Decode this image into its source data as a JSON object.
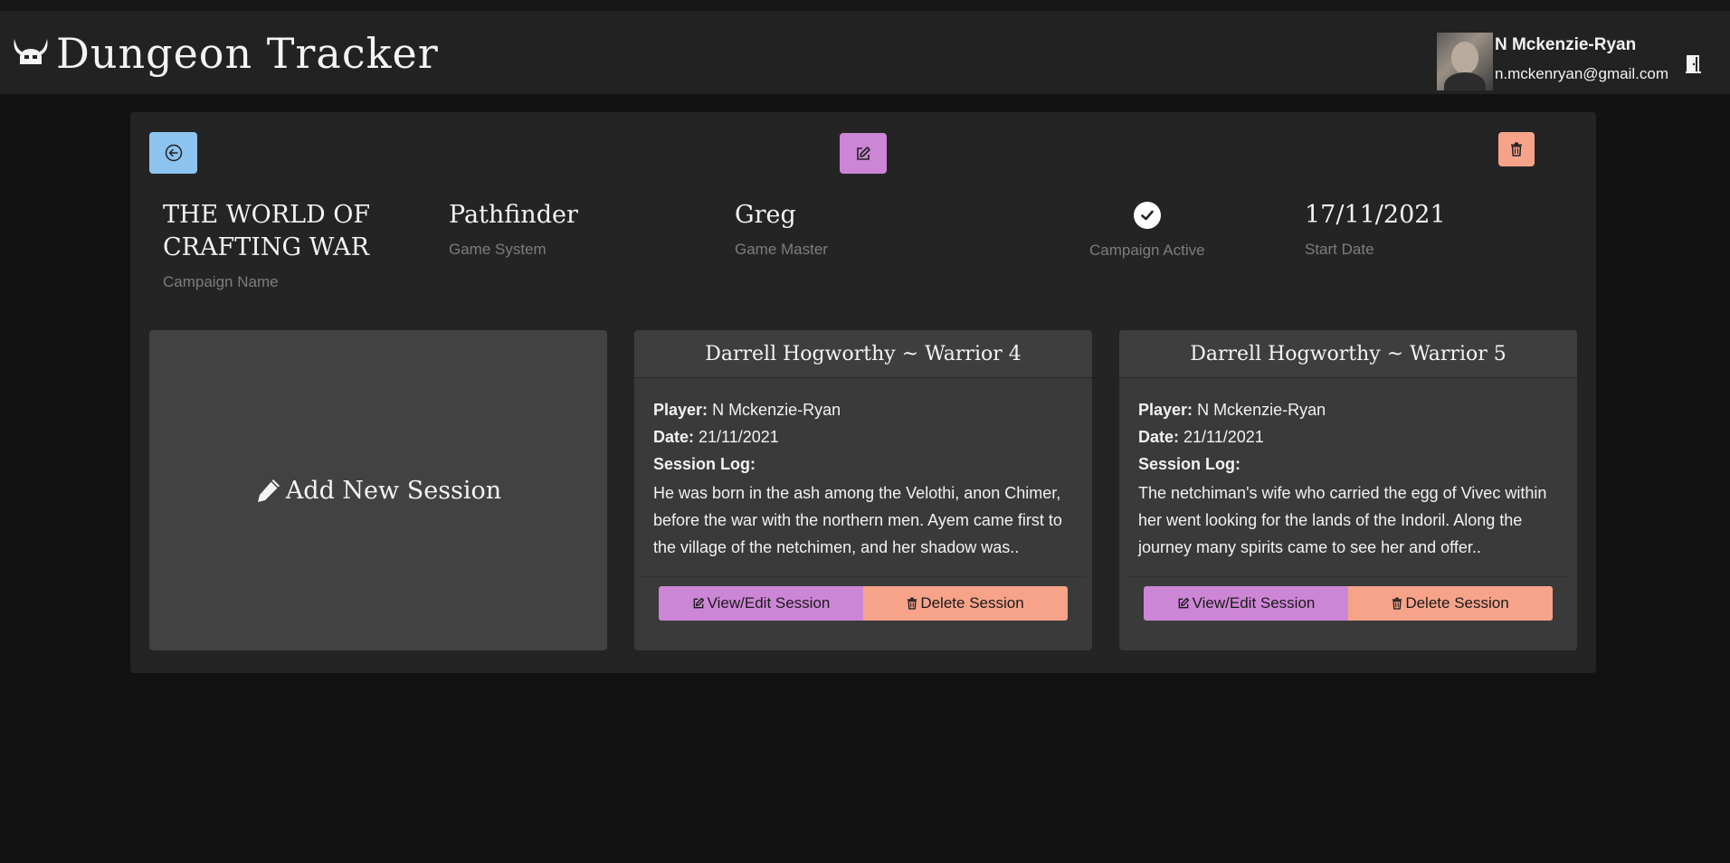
{
  "app": {
    "title": "Dungeon Tracker",
    "user_name": "N Mckenzie-Ryan",
    "user_email": "n.mckenryan@gmail.com"
  },
  "campaign": {
    "name": "THE WORLD OF CRAFTING WAR",
    "name_label": "Campaign Name",
    "system": "Pathfinder",
    "system_label": "Game System",
    "game_master": "Greg",
    "game_master_label": "Game Master",
    "active": true,
    "active_label": "Campaign Active",
    "start_date": "17/11/2021",
    "start_date_label": "Start Date"
  },
  "add_session_label": "Add New Session",
  "labels": {
    "player": "Player:",
    "date": "Date:",
    "session_log": "Session Log:",
    "view_edit": "View/Edit Session",
    "delete": "Delete Session"
  },
  "sessions": [
    {
      "title": "Darrell Hogworthy ~ Warrior 4",
      "player": "N Mckenzie-Ryan",
      "date": "21/11/2021",
      "log": "He was born in the ash among the Velothi, anon Chimer, before the war with the northern men. Ayem came first to the village of the netchimen, and her shadow was.."
    },
    {
      "title": "Darrell Hogworthy ~ Warrior 5",
      "player": "N Mckenzie-Ryan",
      "date": "21/11/2021",
      "log": "The netchiman's wife who carried the egg of Vivec within her went looking for the lands of the Indoril. Along the journey many spirits came to see her and offer.."
    }
  ],
  "colors": {
    "back_button": "#8cc4ef",
    "edit_button": "#cd86d6",
    "delete_button": "#f6a38a"
  },
  "icons": {
    "logo": "horned-helmet-icon",
    "logout": "door-icon",
    "back": "arrow-left-circle-icon",
    "edit": "pencil-square-icon",
    "delete": "trash-icon",
    "active": "check-circle-icon",
    "add": "pencil-icon"
  }
}
